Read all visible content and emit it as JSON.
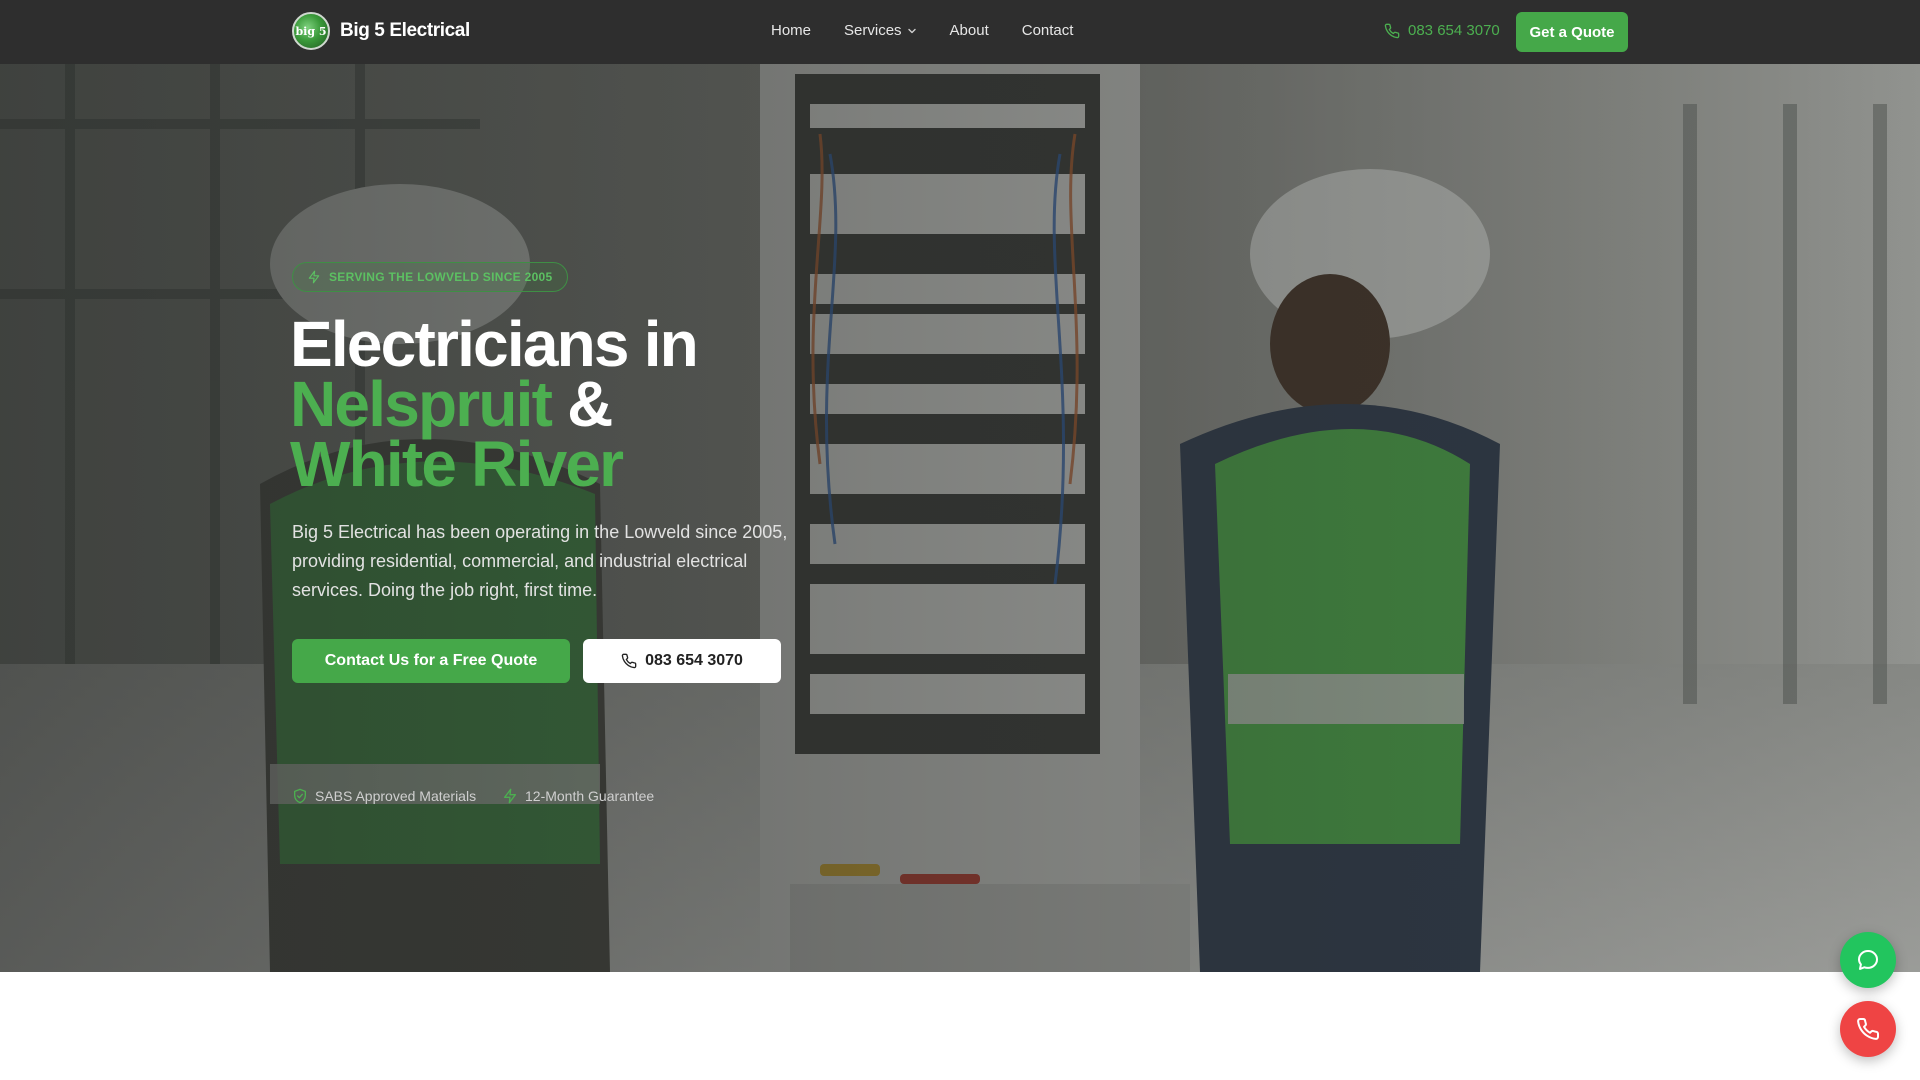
{
  "header": {
    "logo_text": "big 5",
    "brand_name": "Big 5 Electrical",
    "nav": [
      {
        "label": "Home"
      },
      {
        "label": "Services",
        "has_dropdown": true
      },
      {
        "label": "About"
      },
      {
        "label": "Contact"
      }
    ],
    "phone": "083 654 3070",
    "quote_button": "Get a Quote"
  },
  "hero": {
    "badge": "SERVING THE LOWVELD SINCE 2005",
    "headline": {
      "line1": "Electricians in",
      "highlight1": "Nelspruit",
      "connector": "&",
      "highlight2": "White River"
    },
    "description": "Big 5 Electrical has been operating in the Lowveld since 2005, providing residential, commercial, and industrial electrical services. Doing the job right, first time.",
    "cta_primary": "Contact Us for a Free Quote",
    "cta_phone": "083 654 3070",
    "trust": [
      {
        "icon": "shield-icon",
        "label": "SABS Approved Materials"
      },
      {
        "icon": "bolt-icon",
        "label": "12-Month Guarantee"
      }
    ]
  },
  "floating_buttons": [
    {
      "icon": "chat-icon",
      "color": "#22c55e"
    },
    {
      "icon": "phone-icon",
      "color": "#ef4444"
    }
  ],
  "colors": {
    "accent": "#45a849",
    "header_bg": "#2e2e2e"
  }
}
